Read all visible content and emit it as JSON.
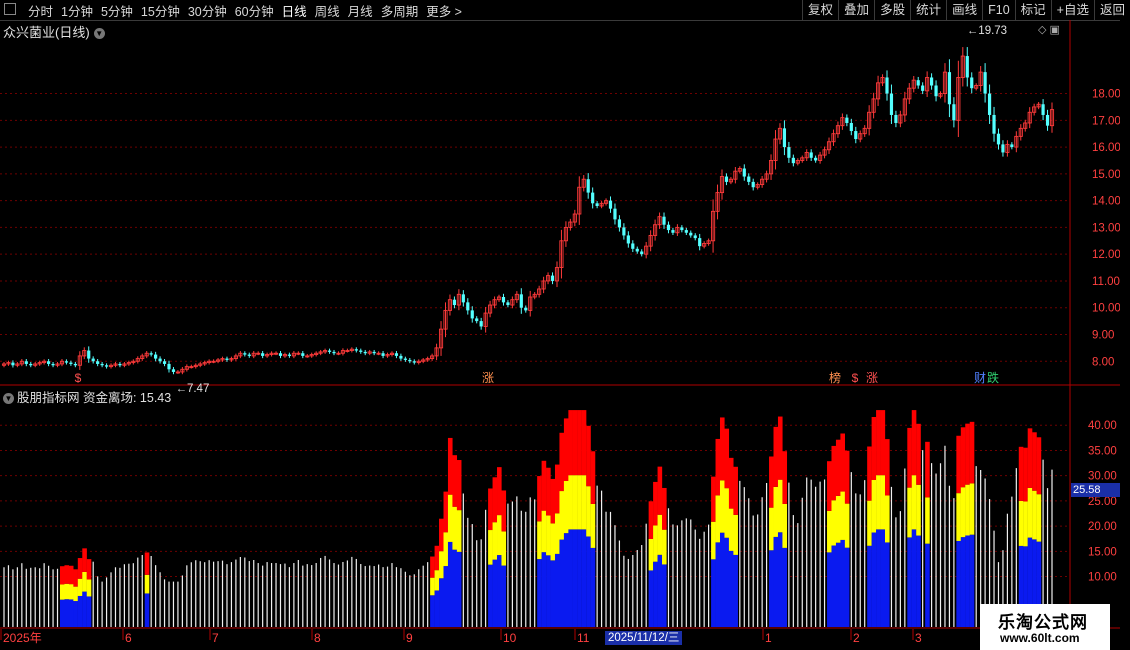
{
  "toolbar": {
    "periods": [
      "分时",
      "1分钟",
      "5分钟",
      "15分钟",
      "30分钟",
      "60分钟",
      "日线",
      "周线",
      "月线",
      "多周期",
      "更多 >"
    ],
    "active_period": "日线",
    "actions": [
      "复权",
      "叠加",
      "多股",
      "统计",
      "画线",
      "F10",
      "标记",
      "+自选",
      "返回"
    ]
  },
  "main_chart": {
    "title": "众兴菌业(日线)",
    "high_label": "19.73",
    "low_label": "7.47",
    "y_ticks": [
      "18.00",
      "17.00",
      "16.00",
      "15.00",
      "14.00",
      "13.00",
      "12.00",
      "11.00",
      "10.00",
      "9.00",
      "8.00"
    ],
    "markers": [
      {
        "text": "$",
        "color": "#ff5050"
      },
      {
        "text": "涨",
        "color": "#ff9050"
      },
      {
        "text": "榜",
        "color": "#ff9050"
      },
      {
        "text": "$",
        "color": "#ff5050"
      },
      {
        "text": "涨",
        "color": "#ff5050"
      },
      {
        "text": "财",
        "color": "#5080ff"
      },
      {
        "text": "跌",
        "color": "#30d070"
      }
    ]
  },
  "sub_chart": {
    "title": "股朋指标网 资金离场: 15.43",
    "y_ticks": [
      "40.00",
      "35.00",
      "30.00",
      "25.00",
      "20.00",
      "15.00",
      "10.00"
    ],
    "current_value": "25.58"
  },
  "x_axis": {
    "labels": [
      "2025年",
      "6",
      "7",
      "8",
      "9",
      "10",
      "11",
      "1",
      "2",
      "3"
    ],
    "cursor_date": "2025/11/12/三"
  },
  "watermark": {
    "line1": "乐淘公式网",
    "line2": "www.60lt.com"
  },
  "colors": {
    "up": "#ff3a3a",
    "down": "#54ffff",
    "grid": "#6e0000",
    "blue": "#0a1af0",
    "yellow": "#ffff00",
    "red": "#ff0000"
  },
  "chart_data": {
    "type": "candlestick",
    "ylim": [
      7.3,
      20.0
    ],
    "closes": [
      7.9,
      7.95,
      7.85,
      7.9,
      8.0,
      7.9,
      7.85,
      7.9,
      7.95,
      8.0,
      7.9,
      7.85,
      7.9,
      8.0,
      7.95,
      7.9,
      7.85,
      8.2,
      8.4,
      8.1,
      8.0,
      7.9,
      7.85,
      7.8,
      7.85,
      7.9,
      7.85,
      7.9,
      7.95,
      8.0,
      8.1,
      8.2,
      8.3,
      8.25,
      8.1,
      8.0,
      7.9,
      7.7,
      7.6,
      7.6,
      7.7,
      7.8,
      7.8,
      7.85,
      7.9,
      7.95,
      8.0,
      8.0,
      8.05,
      8.1,
      8.05,
      8.1,
      8.2,
      8.3,
      8.25,
      8.2,
      8.3,
      8.3,
      8.2,
      8.25,
      8.3,
      8.3,
      8.2,
      8.25,
      8.2,
      8.3,
      8.3,
      8.2,
      8.2,
      8.25,
      8.3,
      8.35,
      8.4,
      8.35,
      8.3,
      8.3,
      8.4,
      8.4,
      8.45,
      8.4,
      8.35,
      8.3,
      8.35,
      8.3,
      8.3,
      8.2,
      8.25,
      8.3,
      8.2,
      8.1,
      8.05,
      8.0,
      7.95,
      8.0,
      8.05,
      8.1,
      8.2,
      8.5,
      9.2,
      9.9,
      10.3,
      10.1,
      10.5,
      10.2,
      9.9,
      9.6,
      9.5,
      9.3,
      9.8,
      10.1,
      10.3,
      10.4,
      10.2,
      10.1,
      10.3,
      10.5,
      10.0,
      9.9,
      10.4,
      10.5,
      10.7,
      11.0,
      11.2,
      11.0,
      11.5,
      12.5,
      13.0,
      13.2,
      13.5,
      14.5,
      14.8,
      14.3,
      13.9,
      13.8,
      13.9,
      14.0,
      13.7,
      13.3,
      13.0,
      12.7,
      12.4,
      12.2,
      12.1,
      12.0,
      12.3,
      12.7,
      13.1,
      13.4,
      13.1,
      12.9,
      12.8,
      13.0,
      12.9,
      12.8,
      12.7,
      12.6,
      12.3,
      12.4,
      12.5,
      13.6,
      14.3,
      14.9,
      14.7,
      14.8,
      15.1,
      15.2,
      14.9,
      14.7,
      14.5,
      14.6,
      14.8,
      15.0,
      15.5,
      16.3,
      16.7,
      16.0,
      15.6,
      15.4,
      15.5,
      15.6,
      15.8,
      15.6,
      15.5,
      15.7,
      15.9,
      16.2,
      16.5,
      16.8,
      17.1,
      16.9,
      16.6,
      16.3,
      16.5,
      16.7,
      17.3,
      17.8,
      18.4,
      18.6,
      18.0,
      17.2,
      16.9,
      17.2,
      17.8,
      18.2,
      18.5,
      18.3,
      18.1,
      18.6,
      18.3,
      17.9,
      18.0,
      18.8,
      17.6,
      17.0,
      18.6,
      19.4,
      18.6,
      18.2,
      18.3,
      18.8,
      18.0,
      17.2,
      16.5,
      16.1,
      15.8,
      16.1,
      16.0,
      16.4,
      16.7,
      16.9,
      17.3,
      17.5,
      17.6,
      17.2,
      16.8,
      17.4
    ]
  }
}
